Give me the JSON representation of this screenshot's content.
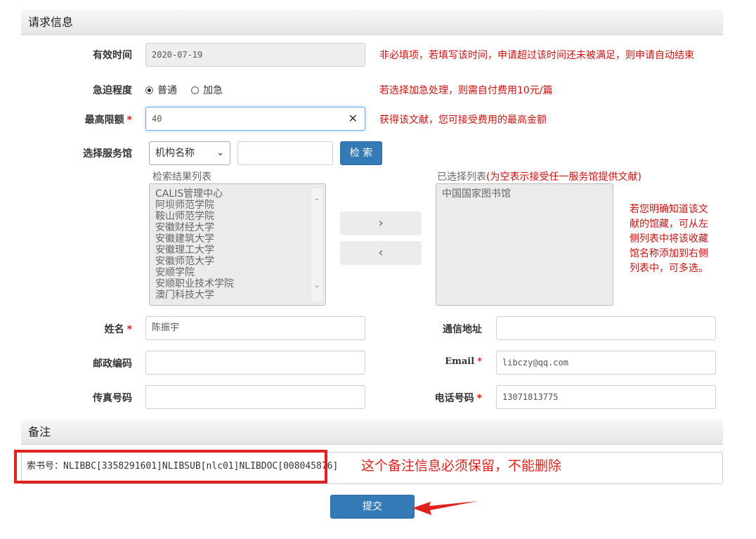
{
  "sections": {
    "request_info": "请求信息",
    "remark": "备注"
  },
  "fields": {
    "valid_time": {
      "label": "有效时间",
      "value": "2020-07-19",
      "hint": "非必填项，若填写该时间，申请超过该时间还未被满足，则申请自动结束"
    },
    "urgency": {
      "label": "急迫程度",
      "options": [
        "普通",
        "加急"
      ],
      "selected": "普通",
      "hint": "若选择加急处理，则需自付费用10元/篇"
    },
    "max_limit": {
      "label": "最高限额",
      "value": "40",
      "hint": "获得该文献，您可接受费用的最高金额"
    },
    "service_lib": {
      "label": "选择服务馆",
      "select_value": "机构名称",
      "search_value": "",
      "search_button": "检 索"
    },
    "name": {
      "label": "姓名",
      "value": "陈振宇"
    },
    "address": {
      "label": "通信地址",
      "value": ""
    },
    "postcode": {
      "label": "邮政编码",
      "value": ""
    },
    "email": {
      "label": "Email",
      "value": "libczy@qq.com"
    },
    "fax": {
      "label": "传真号码",
      "value": ""
    },
    "phone": {
      "label": "电话号码",
      "value": "13071813775"
    }
  },
  "required_mark": "*",
  "results": {
    "label": "检索结果列表",
    "items": [
      "CALIS管理中心",
      "阿坝师范学院",
      "鞍山师范学院",
      "安徽财经大学",
      "安徽建筑大学",
      "安徽理工大学",
      "安徽师范大学",
      "安顺学院",
      "安顺职业技术学院",
      "澳门科技大学"
    ]
  },
  "selected": {
    "label": "已选择列表",
    "label_note": "(为空表示接受任一服务馆提供文献)",
    "items": [
      "中国国家图书馆"
    ],
    "side_note": [
      "若您明确知道该文",
      "献的馆藏，可从左",
      "侧列表中将该收藏",
      "馆名称添加到右侧",
      "列表中，可多选。"
    ]
  },
  "move_buttons": {
    "add": "›",
    "remove": "‹"
  },
  "remark": {
    "value": "索书号：NLIBBC[3358291601]NLIBSUB[nlc01]NLIBDOC[008045876]",
    "annotation": "这个备注信息必须保留，不能删除"
  },
  "submit": "提交",
  "colors": {
    "primary": "#337ab7",
    "hint_red": "#cc1111",
    "annotation_red": "#e3211c"
  }
}
